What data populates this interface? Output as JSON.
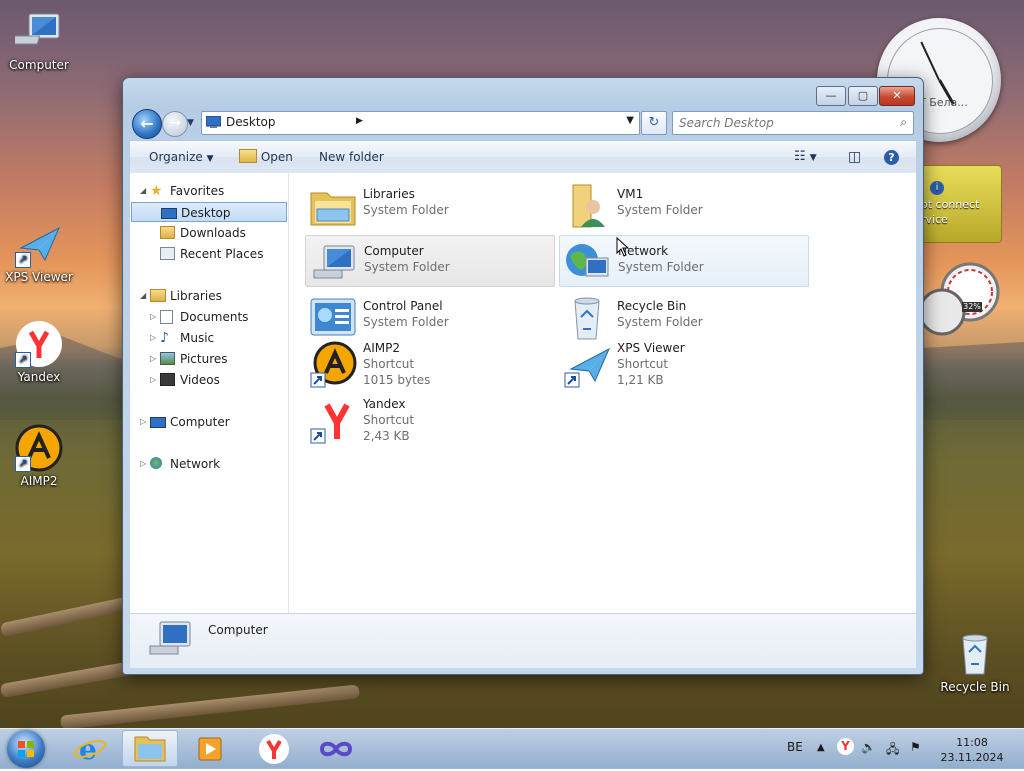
{
  "desktop": {
    "icons": [
      {
        "label": "Computer"
      },
      {
        "label": "XPS Viewer"
      },
      {
        "label": "Yandex"
      },
      {
        "label": "AIMP2"
      },
      {
        "label": "Recycle Bin"
      }
    ],
    "gadgets": {
      "clock_label": "T Бела...",
      "weather_line1": "ot connect",
      "weather_line2": "rvice",
      "cpu_percent": "32%"
    }
  },
  "window": {
    "controls": {
      "minimize": "—",
      "maximize": "▢",
      "close": "✕"
    },
    "address": {
      "label": "Desktop"
    },
    "search": {
      "placeholder": "Search Desktop"
    },
    "toolbar": {
      "organize": "Organize",
      "open": "Open",
      "new_folder": "New folder"
    },
    "nav": {
      "favorites": "Favorites",
      "desktop": "Desktop",
      "downloads": "Downloads",
      "recent_places": "Recent Places",
      "libraries": "Libraries",
      "documents": "Documents",
      "music": "Music",
      "pictures": "Pictures",
      "videos": "Videos",
      "computer": "Computer",
      "network": "Network"
    },
    "items": [
      {
        "name": "Libraries",
        "type": "System Folder",
        "size": ""
      },
      {
        "name": "VM1",
        "type": "System Folder",
        "size": ""
      },
      {
        "name": "Computer",
        "type": "System Folder",
        "size": ""
      },
      {
        "name": "Network",
        "type": "System Folder",
        "size": ""
      },
      {
        "name": "Control Panel",
        "type": "System Folder",
        "size": ""
      },
      {
        "name": "Recycle Bin",
        "type": "System Folder",
        "size": ""
      },
      {
        "name": "AIMP2",
        "type": "Shortcut",
        "size": "1015 bytes"
      },
      {
        "name": "XPS Viewer",
        "type": "Shortcut",
        "size": "1,21 KB"
      },
      {
        "name": "Yandex",
        "type": "Shortcut",
        "size": "2,43 KB"
      }
    ],
    "details": {
      "selected_name": "Computer"
    }
  },
  "taskbar": {
    "language": "BE",
    "time": "11:08",
    "date": "23.11.2024"
  }
}
